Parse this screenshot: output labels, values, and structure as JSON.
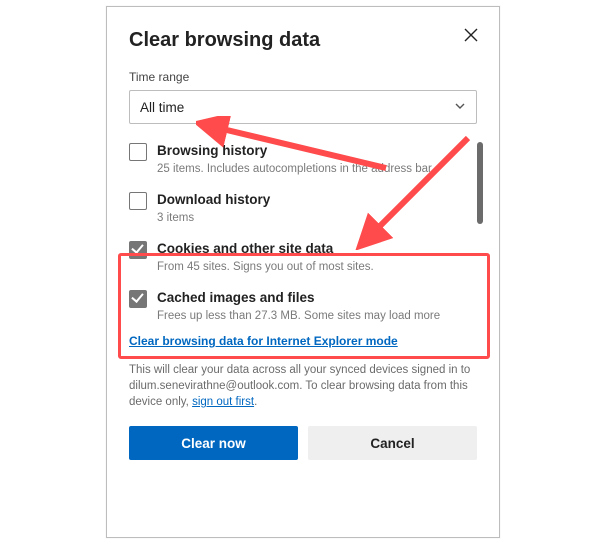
{
  "dialog": {
    "title": "Clear browsing data",
    "time_range_label": "Time range",
    "time_range_value": "All time"
  },
  "options": [
    {
      "label": "Browsing history",
      "sub": "25 items. Includes autocompletions in the address bar.",
      "checked": false
    },
    {
      "label": "Download history",
      "sub": "3 items",
      "checked": false
    },
    {
      "label": "Cookies and other site data",
      "sub": "From 45 sites. Signs you out of most sites.",
      "checked": true
    },
    {
      "label": "Cached images and files",
      "sub": "Frees up less than 27.3 MB. Some sites may load more",
      "checked": true
    }
  ],
  "ie_link": "Clear browsing data for Internet Explorer mode",
  "sync": {
    "prefix": "This will clear your data across all your synced devices signed in to ",
    "email": "dilum.senevirathne@outlook.com",
    "middle": ". To clear browsing data from this device only, ",
    "link": "sign out first",
    "suffix": "."
  },
  "buttons": {
    "primary": "Clear now",
    "secondary": "Cancel"
  }
}
